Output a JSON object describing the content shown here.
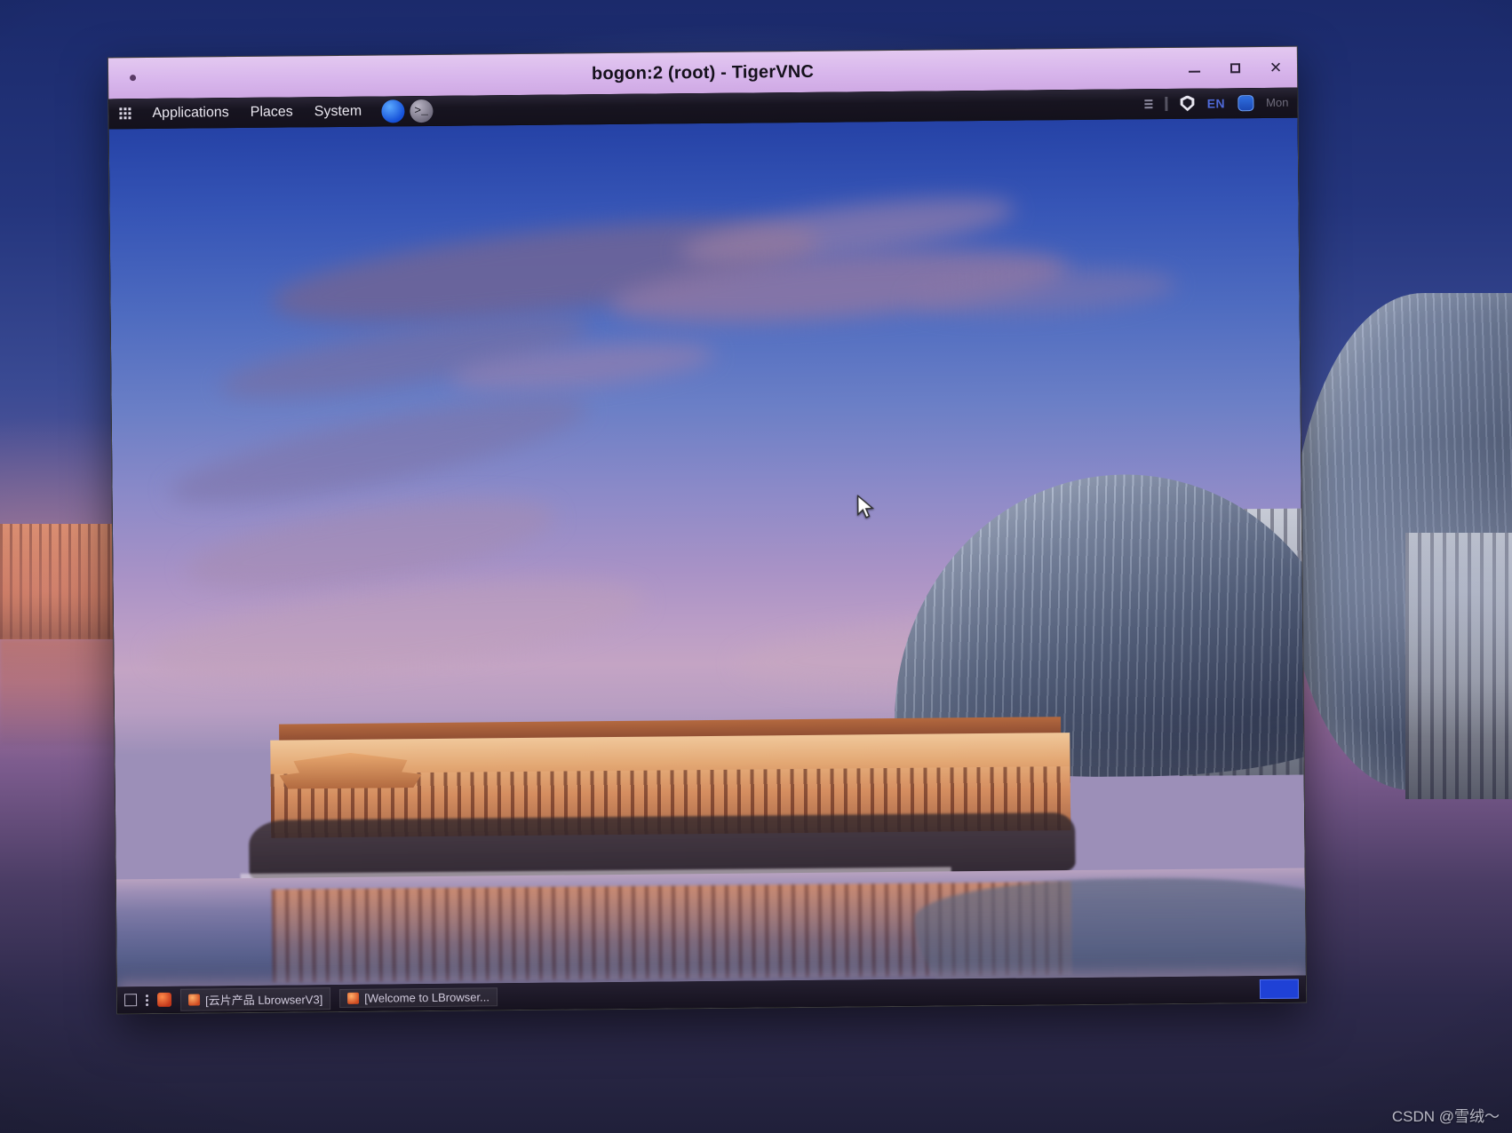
{
  "window": {
    "title": "bogon:2 (root) - TigerVNC",
    "controls": {
      "minimize": "–",
      "maximize": "□",
      "close": "✕"
    },
    "menu_dot": "•"
  },
  "top_panel": {
    "apps_grid_icon": "grid-icon",
    "menus": [
      {
        "label": "Applications"
      },
      {
        "label": "Places"
      },
      {
        "label": "System"
      }
    ],
    "launchers": [
      {
        "name": "browser-launcher",
        "glyph": ""
      },
      {
        "name": "terminal-launcher",
        "glyph": ">_"
      }
    ],
    "tray": {
      "separator_icon": "tray-separator",
      "dots_icon": "tray-dots-icon",
      "shield_icon": "shield-icon",
      "language": "EN",
      "blue_icon": "security-icon",
      "clock_text": "Mon"
    }
  },
  "desktop": {
    "cursor": "pointer-cursor",
    "wallpaper_name": "beijing-npac-sunset"
  },
  "bottom_panel": {
    "show_desktop_icon": "show-desktop-icon",
    "workspace_dots_icon": "workspace-dots-icon",
    "app_icon": "app-icon",
    "tasks": [
      {
        "label": "[云片产品  LbrowserV3]"
      },
      {
        "label": "[Welcome to LBrowser..."
      }
    ],
    "tray_highlight": "blue-indicator"
  },
  "watermark": {
    "text": "CSDN @雪绒～"
  }
}
